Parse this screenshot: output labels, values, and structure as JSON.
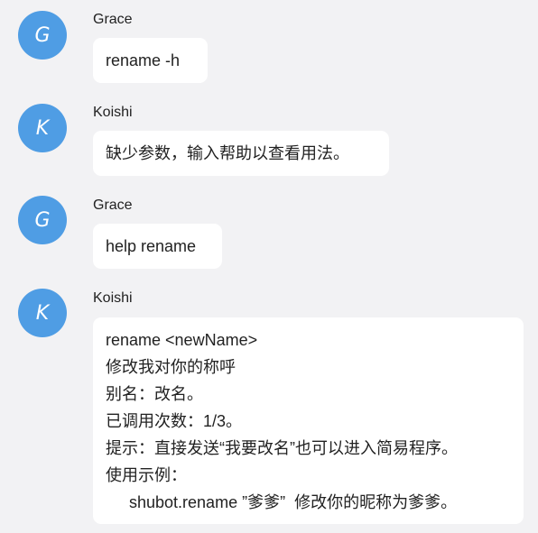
{
  "messages": [
    {
      "sender": "Grace",
      "avatar_letter": "G",
      "lines": [
        "rename -h"
      ]
    },
    {
      "sender": "Koishi",
      "avatar_letter": "K",
      "lines": [
        "缺少参数，输入帮助以查看用法。"
      ]
    },
    {
      "sender": "Grace",
      "avatar_letter": "G",
      "lines": [
        "help rename"
      ]
    },
    {
      "sender": "Koishi",
      "avatar_letter": "K",
      "lines": [
        "rename <newName>",
        "修改我对你的称呼",
        "别名：改名。",
        "已调用次数：1/3。",
        "提示：直接发送“我要改名”也可以进入简易程序。",
        "使用示例：",
        "shubot.rename ”爹爹”  修改你的昵称为爹爹。"
      ]
    }
  ],
  "colors": {
    "background": "#f2f2f4",
    "avatar": "#4f9de4",
    "bubble": "#ffffff",
    "text": "#222222"
  }
}
